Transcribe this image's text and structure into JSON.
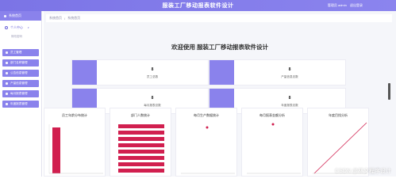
{
  "app": {
    "title": "服装工厂移动报表软件设计",
    "user_greeting": "管理员 admin",
    "logout": "退出登录"
  },
  "sidebar": {
    "home": "系统首页",
    "profile": "个人中心",
    "profile_sub": "修改密码",
    "items": [
      {
        "label": "员工管理"
      },
      {
        "label": "部门名称管理"
      },
      {
        "label": "公告信息管理"
      },
      {
        "label": "产量信息管理"
      },
      {
        "label": "每月报表管理"
      },
      {
        "label": "年度报表管理"
      }
    ]
  },
  "breadcrumb": {
    "home": "系统首页",
    "current": "系统首页"
  },
  "welcome": "欢迎使用 服装工厂移动报表软件设计",
  "stats": [
    {
      "value": "8",
      "label": "员工总数"
    },
    {
      "value": "8",
      "label": "产量信息总数"
    },
    {
      "value": "8",
      "label": "每月报表总数"
    },
    {
      "value": "8",
      "label": "年度报表总数"
    }
  ],
  "chart_data": [
    {
      "type": "bar",
      "title": "员工年龄分布统计",
      "categories": [],
      "values": [
        8
      ],
      "ylim": [
        0,
        9
      ],
      "color": "#d11f4f"
    },
    {
      "type": "bar",
      "title": "部门人数统计",
      "categories": [],
      "values": [
        9,
        9,
        9,
        9,
        9,
        9,
        9,
        9
      ],
      "xlim": [
        0,
        10
      ],
      "orientation": "horizontal",
      "color": "#d11f4f"
    },
    {
      "type": "scatter",
      "title": "每月生产数据统计",
      "x": [
        1
      ],
      "y": [
        1
      ],
      "color": "#d11f4f"
    },
    {
      "type": "scatter",
      "title": "每月报表金额分析",
      "x": [
        1
      ],
      "y": [
        1
      ],
      "color": "#d11f4f"
    },
    {
      "type": "line",
      "title": "年度目找分析",
      "x": [
        0,
        1
      ],
      "y": [
        0,
        1
      ],
      "color": "#d11f4f"
    }
  ],
  "watermark": "CSDN @林文程序设计"
}
